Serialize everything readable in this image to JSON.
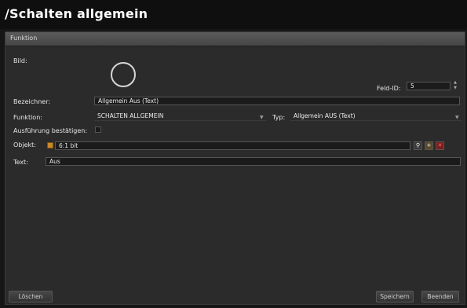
{
  "window": {
    "title": "/Schalten allgemein"
  },
  "section": {
    "label": "Funktion"
  },
  "form": {
    "bild_label": "Bild:",
    "feld_id_label": "Feld-ID:",
    "feld_id_value": "5",
    "bezeichner_label": "Bezeichner:",
    "bezeichner_value": "Allgemein Aus (Text)",
    "funktion_label": "Funktion:",
    "funktion_value": "SCHALTEN ALLGEMEIN",
    "typ_label": "Typ:",
    "typ_value": "Allgemein AUS (Text)",
    "ausfuehrung_label": "Ausführung bestätigen:",
    "ausfuehrung_checked": false,
    "objekt_label": "Objekt:",
    "objekt_value": "6:1 bit",
    "text_label": "Text:",
    "text_value": "Aus"
  },
  "buttons": {
    "delete": "Löschen",
    "save": "Speichern",
    "close": "Beenden"
  },
  "icons": {
    "image_preview": "ring-icon",
    "objekt": "box-icon",
    "search": "search-icon",
    "add_object": "box-add-icon",
    "remove_object": "remove-icon"
  }
}
